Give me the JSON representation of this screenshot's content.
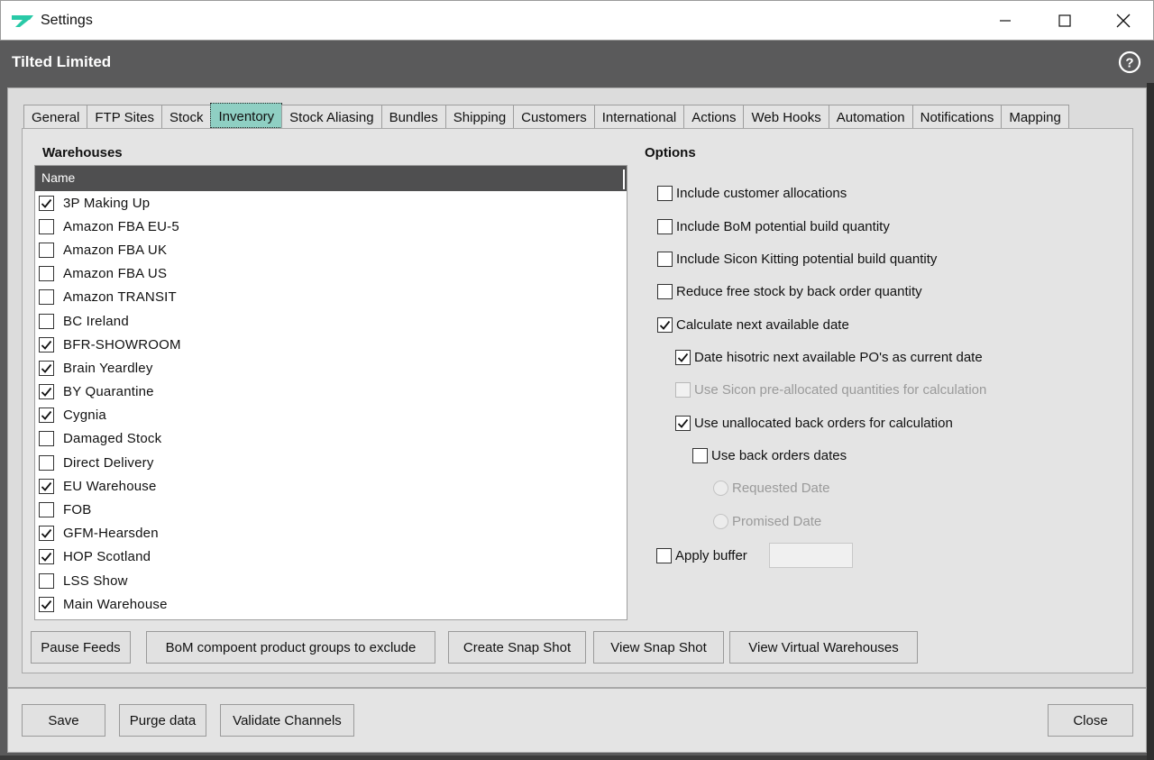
{
  "window": {
    "title": "Settings",
    "company": "Tilted Limited"
  },
  "colors": {
    "brand_logo": "#29c9a7",
    "header_bg": "#5a5a5b",
    "active_tab": "#8fcfc3"
  },
  "tabs": [
    "General",
    "FTP Sites",
    "Stock",
    "Inventory",
    "Stock Aliasing",
    "Bundles",
    "Shipping",
    "Customers",
    "International",
    "Actions",
    "Web Hooks",
    "Automation",
    "Notifications",
    "Mapping"
  ],
  "active_tab": "Inventory",
  "warehouses": {
    "label": "Warehouses",
    "column_header": "Name",
    "items": [
      {
        "name": "3P Making Up",
        "checked": true
      },
      {
        "name": "Amazon FBA EU-5",
        "checked": false
      },
      {
        "name": "Amazon FBA UK",
        "checked": false
      },
      {
        "name": "Amazon FBA US",
        "checked": false
      },
      {
        "name": "Amazon TRANSIT",
        "checked": false
      },
      {
        "name": "BC Ireland",
        "checked": false
      },
      {
        "name": "BFR-SHOWROOM",
        "checked": true
      },
      {
        "name": "Brain Yeardley",
        "checked": true
      },
      {
        "name": "BY Quarantine",
        "checked": true
      },
      {
        "name": "Cygnia",
        "checked": true
      },
      {
        "name": "Damaged Stock",
        "checked": false
      },
      {
        "name": "Direct Delivery",
        "checked": false
      },
      {
        "name": "EU Warehouse",
        "checked": true
      },
      {
        "name": "FOB",
        "checked": false
      },
      {
        "name": "GFM-Hearsden",
        "checked": true
      },
      {
        "name": "HOP Scotland",
        "checked": true
      },
      {
        "name": "LSS Show",
        "checked": false
      },
      {
        "name": "Main Warehouse",
        "checked": true
      }
    ]
  },
  "options": {
    "label": "Options",
    "include_customer_allocations": {
      "label": "Include customer allocations",
      "checked": false
    },
    "include_bom_potential": {
      "label": "Include BoM potential build quantity",
      "checked": false
    },
    "include_sicon_kitting": {
      "label": "Include Sicon Kitting potential build quantity",
      "checked": false
    },
    "reduce_free_stock": {
      "label": "Reduce free stock by back order quantity",
      "checked": false
    },
    "calculate_next_available": {
      "label": "Calculate next available date",
      "checked": true
    },
    "date_historic_po": {
      "label": "Date hisotric next available PO's as current date",
      "checked": true
    },
    "use_sicon_preallocated": {
      "label": "Use Sicon pre-allocated quantities for calculation",
      "checked": false,
      "disabled": true
    },
    "use_unallocated_back_orders": {
      "label": "Use unallocated back orders for calculation",
      "checked": true
    },
    "use_back_order_dates": {
      "label": "Use back orders dates",
      "checked": false
    },
    "requested_date": {
      "label": "Requested Date"
    },
    "promised_date": {
      "label": "Promised Date"
    },
    "apply_buffer": {
      "label": "Apply buffer",
      "checked": false,
      "value": ""
    }
  },
  "actions": {
    "pause_feeds": "Pause Feeds",
    "bom_exclude": "BoM compoent product groups to exclude",
    "create_snapshot": "Create Snap Shot",
    "view_snapshot": "View Snap Shot",
    "view_virtual_warehouses": "View Virtual Warehouses"
  },
  "footer": {
    "save": "Save",
    "purge_data": "Purge data",
    "validate_channels": "Validate Channels",
    "close": "Close"
  }
}
